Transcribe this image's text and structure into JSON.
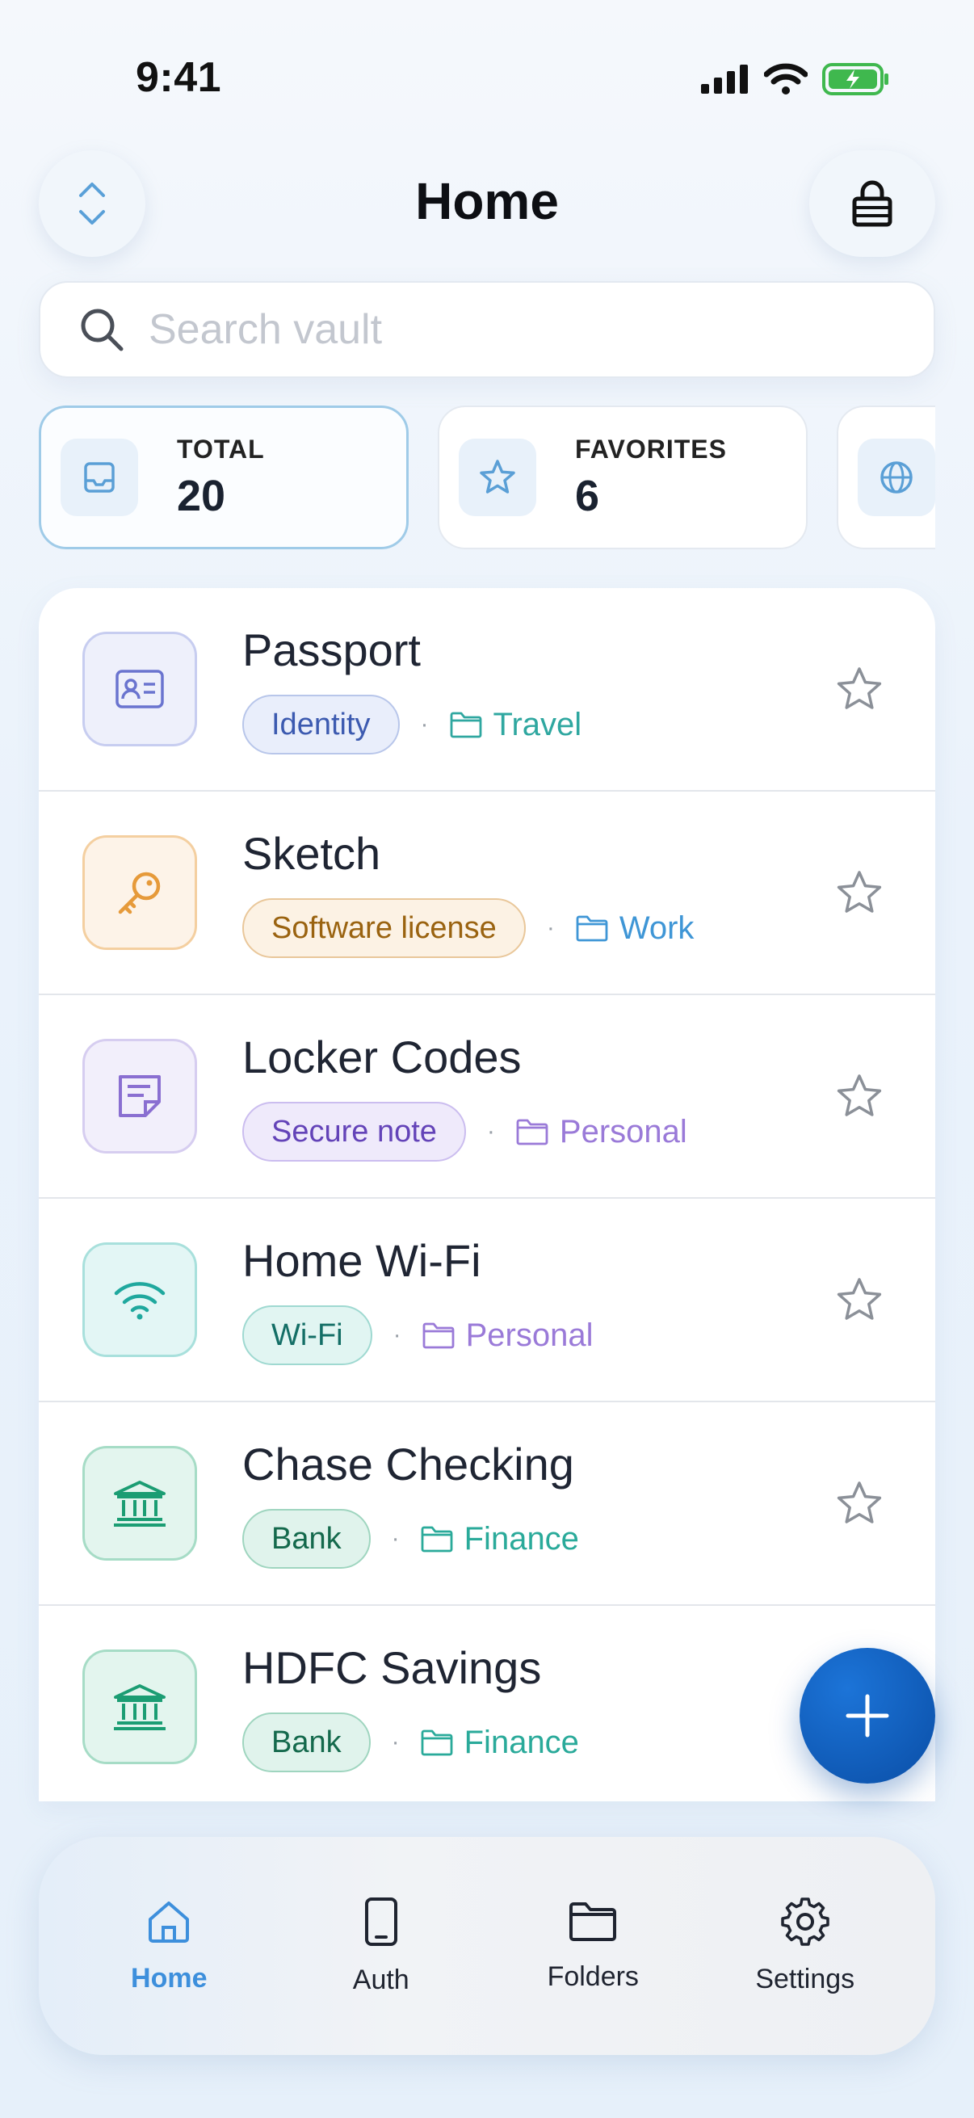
{
  "status_bar": {
    "time": "9:41"
  },
  "header": {
    "title": "Home"
  },
  "search": {
    "placeholder": "Search vault"
  },
  "stats": [
    {
      "label": "TOTAL",
      "value": "20",
      "icon": "inbox-icon"
    },
    {
      "label": "FAVORITES",
      "value": "6",
      "icon": "star-icon"
    },
    {
      "label": "",
      "value": "",
      "icon": "globe-icon"
    }
  ],
  "items": [
    {
      "title": "Passport",
      "type": "Identity",
      "folder": "Travel",
      "icon": "id-card-icon",
      "colors": {
        "icon_bg": "#eef0fb",
        "icon_border": "#c7cdf0",
        "icon": "#6a74cf",
        "chip_bg": "#e9eefb",
        "chip_border": "#b8c6ea",
        "chip_text": "#3c5ab0",
        "folder": "#2fa7a0"
      }
    },
    {
      "title": "Sketch",
      "type": "Software license",
      "folder": "Work",
      "icon": "key-icon",
      "colors": {
        "icon_bg": "#fdf3e8",
        "icon_border": "#f4cfa0",
        "icon": "#e69a3a",
        "chip_bg": "#fcf2e4",
        "chip_border": "#e9c79a",
        "chip_text": "#9a6310",
        "folder": "#3f96d6"
      }
    },
    {
      "title": "Locker Codes",
      "type": "Secure note",
      "folder": "Personal",
      "icon": "note-icon",
      "colors": {
        "icon_bg": "#f2effb",
        "icon_border": "#d6cdf0",
        "icon": "#8a6fd1",
        "chip_bg": "#efeafb",
        "chip_border": "#cbbdef",
        "chip_text": "#6343b8",
        "folder": "#9a7ad8"
      }
    },
    {
      "title": "Home Wi-Fi",
      "type": "Wi-Fi",
      "folder": "Personal",
      "icon": "wifi-icon",
      "colors": {
        "icon_bg": "#e3f6f5",
        "icon_border": "#a8e0dc",
        "icon": "#1fa89e",
        "chip_bg": "#e1f5f2",
        "chip_border": "#9fd9d1",
        "chip_text": "#136e66",
        "folder": "#9a7ad8"
      }
    },
    {
      "title": "Chase Checking",
      "type": "Bank",
      "folder": "Finance",
      "icon": "bank-icon",
      "colors": {
        "icon_bg": "#e3f5ee",
        "icon_border": "#a6dcc6",
        "icon": "#1b9d73",
        "chip_bg": "#e0f3ec",
        "chip_border": "#9fd5bf",
        "chip_text": "#14694c",
        "folder": "#2aaa9a"
      }
    },
    {
      "title": "HDFC Savings",
      "type": "Bank",
      "folder": "Finance",
      "icon": "bank-icon",
      "colors": {
        "icon_bg": "#e3f5ee",
        "icon_border": "#a6dcc6",
        "icon": "#1b9d73",
        "chip_bg": "#e0f3ec",
        "chip_border": "#9fd5bf",
        "chip_text": "#14694c",
        "folder": "#2aaa9a"
      }
    }
  ],
  "nav": [
    {
      "label": "Home",
      "icon": "home-icon",
      "active": true
    },
    {
      "label": "Auth",
      "icon": "phone-icon",
      "active": false
    },
    {
      "label": "Folders",
      "icon": "folder-icon",
      "active": false
    },
    {
      "label": "Settings",
      "icon": "gear-icon",
      "active": false
    }
  ],
  "theme": {
    "accent": "#3d8fdc",
    "fab": "#0a4ea6"
  }
}
